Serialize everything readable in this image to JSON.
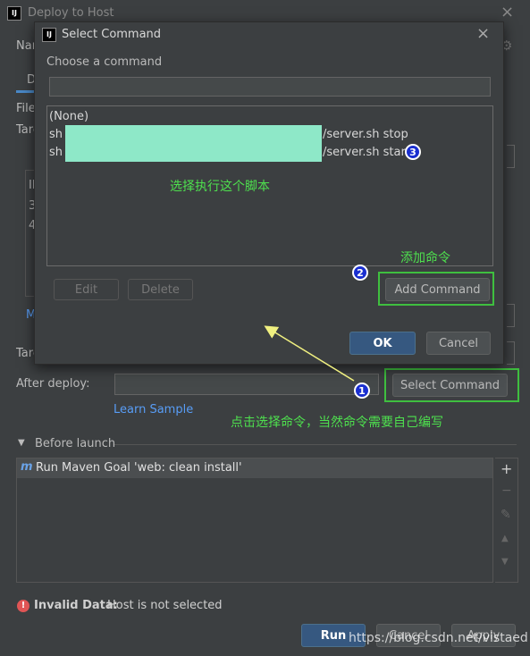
{
  "parent": {
    "title": "Deploy to Host",
    "frag_name": "Nar",
    "frag_tab": "D",
    "frag_file": "File",
    "frag_target": "Tarc",
    "frag_il": "Il",
    "frag_3": "3",
    "frag_4": "4",
    "frag_m": "M",
    "frag_target2": "Tarc",
    "after_deploy_label": "After deploy:",
    "select_command_button": "Select Command",
    "learn_sample_link": "Learn Sample",
    "before_launch_label": "Before launch",
    "task_item": "Run Maven Goal 'web: clean install'",
    "task_tools": {
      "add": "+",
      "remove": "−",
      "edit": "✎",
      "up": "▲",
      "down": "▼"
    },
    "error_bold": "Invalid Data:",
    "error_text": "Host is not selected",
    "run_button": "Run",
    "cancel_button": "Cancel",
    "apply_button": "Apply"
  },
  "dialog": {
    "title": "Select Command",
    "close": "×",
    "choose_label": "Choose a command",
    "search_value": "",
    "commands": [
      {
        "prefix": "(None)",
        "suffix": ""
      },
      {
        "prefix": "sh",
        "suffix": "/server.sh stop"
      },
      {
        "prefix": "sh",
        "suffix": "/server.sh start"
      }
    ],
    "edit_button": "Edit",
    "delete_button": "Delete",
    "add_command_button": "Add Command",
    "ok_button": "OK",
    "cancel_button": "Cancel"
  },
  "annotations": {
    "select_script": "选择执行这个脚本",
    "add_command": "添加命令",
    "click_select": "点击选择命令，当然命令需要自己编写",
    "badge1": "1",
    "badge2": "2",
    "badge3": "3"
  },
  "watermark": "https://blog.csdn.net/vistaed",
  "colors": {
    "background": "#3c3f41",
    "accent_primary": "#365880",
    "highlight_box": "#3fbf3f",
    "annotation_text": "#4ee04e",
    "arrow": "#f0f080",
    "redaction": "#8ee8c8",
    "badge": "#1a2fd0",
    "error_icon": "#e05555"
  },
  "icons": {
    "app": "intellij-logo-icon",
    "maven": "maven-m-icon",
    "error": "error-circle-icon",
    "settings": "gear-icon"
  }
}
